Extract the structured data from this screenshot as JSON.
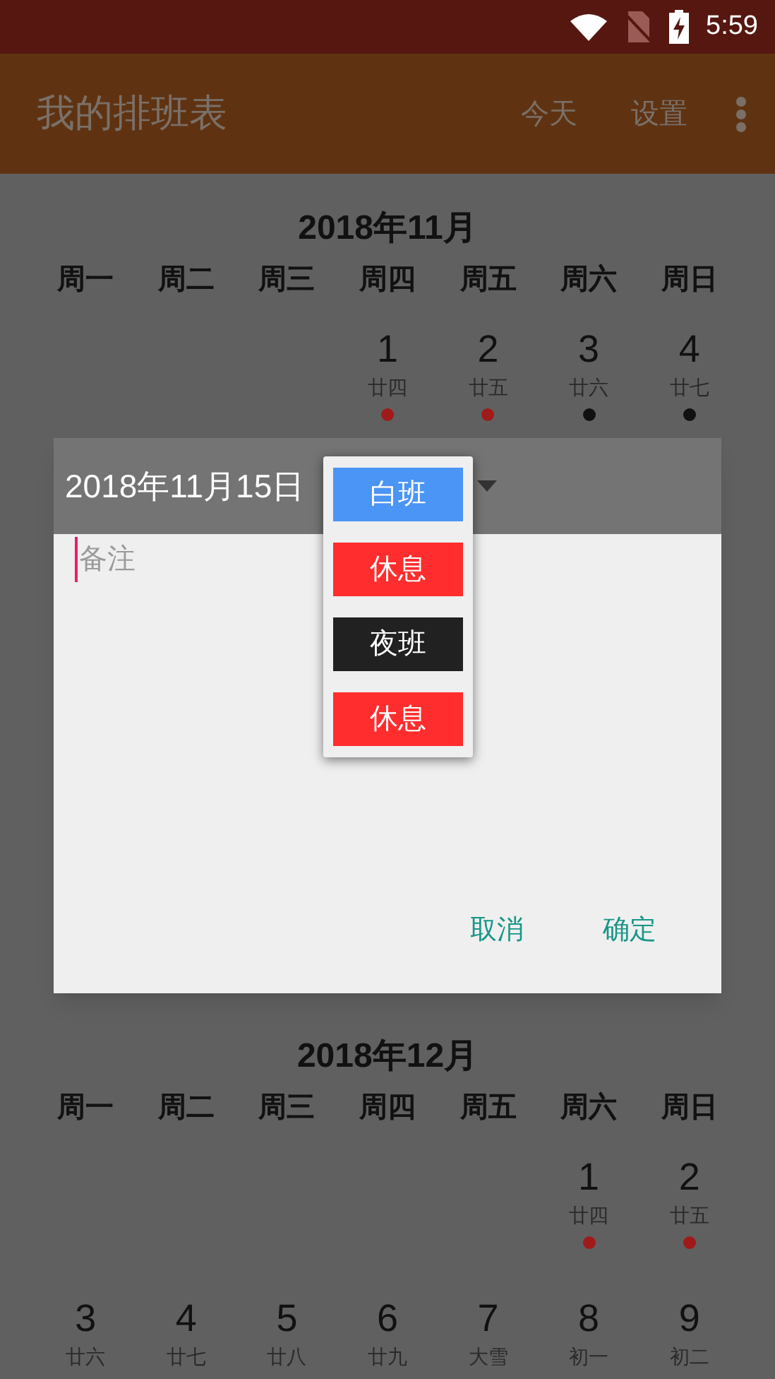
{
  "status_bar": {
    "time": "5:59"
  },
  "app_bar": {
    "title": "我的排班表",
    "actions": [
      "今天",
      "设置"
    ]
  },
  "months": [
    {
      "title": "2018年11月",
      "weekdays": [
        "周一",
        "周二",
        "周三",
        "周四",
        "周五",
        "周六",
        "周日"
      ],
      "rows": [
        [
          {
            "kind": "empty"
          },
          {
            "kind": "empty"
          },
          {
            "kind": "empty"
          },
          {
            "kind": "day",
            "day": "1",
            "lunar": "廿四",
            "color": "#a01a1a"
          },
          {
            "kind": "day",
            "day": "2",
            "lunar": "廿五",
            "color": "#a01a1a"
          },
          {
            "kind": "day",
            "day": "3",
            "lunar": "廿六",
            "color": "#111111"
          },
          {
            "kind": "day",
            "day": "4",
            "lunar": "廿七",
            "color": "#111111"
          }
        ]
      ]
    },
    {
      "title": "2018年12月",
      "weekdays": [
        "周一",
        "周二",
        "周三",
        "周四",
        "周五",
        "周六",
        "周日"
      ],
      "rows": [
        [
          {
            "kind": "empty"
          },
          {
            "kind": "empty"
          },
          {
            "kind": "empty"
          },
          {
            "kind": "empty"
          },
          {
            "kind": "empty"
          },
          {
            "kind": "day",
            "day": "1",
            "lunar": "廿四",
            "color": "#a01a1a"
          },
          {
            "kind": "day",
            "day": "2",
            "lunar": "廿五",
            "color": "#a01a1a"
          }
        ],
        [
          {
            "kind": "day",
            "day": "3",
            "lunar": "廿六"
          },
          {
            "kind": "day",
            "day": "4",
            "lunar": "廿七"
          },
          {
            "kind": "day",
            "day": "5",
            "lunar": "廿八"
          },
          {
            "kind": "day",
            "day": "6",
            "lunar": "廿九"
          },
          {
            "kind": "day",
            "day": "7",
            "lunar": "大雪"
          },
          {
            "kind": "day",
            "day": "8",
            "lunar": "初一"
          },
          {
            "kind": "day",
            "day": "9",
            "lunar": "初二"
          }
        ]
      ]
    }
  ],
  "dialog": {
    "date": "2018年11月15日",
    "note_placeholder": "备注",
    "buttons": [
      "取消",
      "确定"
    ]
  },
  "shift_menu": {
    "items": [
      {
        "label": "白班",
        "color": "#4a95f5"
      },
      {
        "label": "休息",
        "color": "#ff2d2d"
      },
      {
        "label": "夜班",
        "color": "#212121"
      },
      {
        "label": "休息",
        "color": "#ff2d2d"
      }
    ]
  }
}
